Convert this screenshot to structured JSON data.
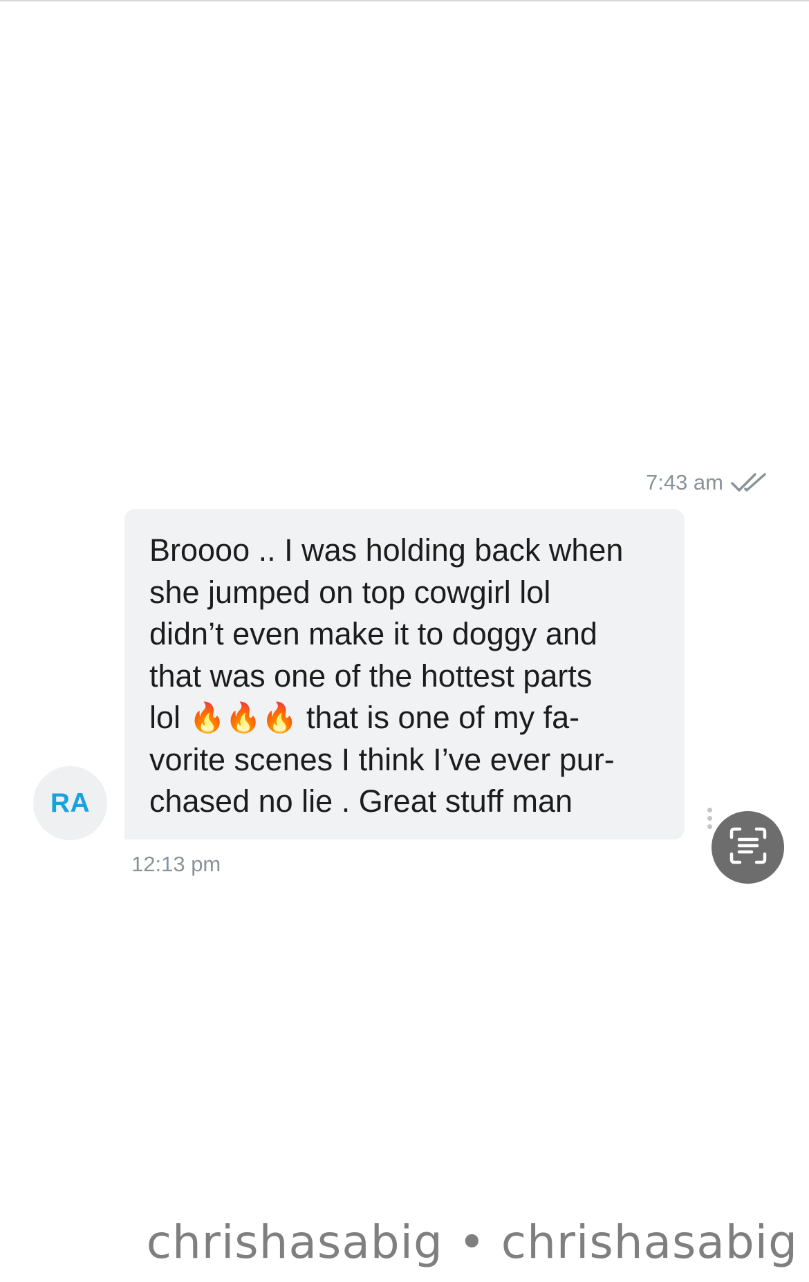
{
  "sent_message": {
    "time": "7:43 am",
    "status_icon": "double-check-icon"
  },
  "received_message": {
    "avatar_initials": "RA",
    "lines": [
      "Broooo .. I was holding back when",
      "she jumped on top cowgirl lol",
      "didn’t even make it to doggy and",
      "that was one of the hottest parts",
      "lol",
      "that is one of my fa-",
      "vorite scenes I think I’ve ever pur-",
      "chased no lie . Great stuff man"
    ],
    "emoji": [
      "🔥",
      "🔥",
      "🔥"
    ],
    "time": "12:13 pm"
  },
  "actions": {
    "more_icon": "more-vertical-icon",
    "scan_text_icon": "scan-text-icon"
  },
  "watermark": "chrishasabig • chrishasabig",
  "colors": {
    "bubble": "#f0f2f3",
    "avatar_text": "#1ba1e2",
    "meta_text": "#8a9299",
    "scan_button": "#6d6d6d"
  }
}
